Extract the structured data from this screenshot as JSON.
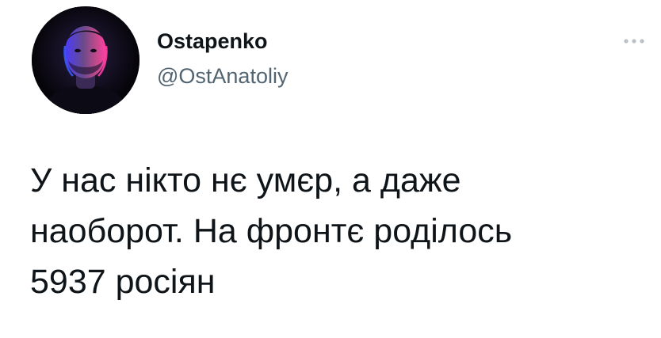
{
  "author": {
    "display_name": "Ostapenko",
    "handle": "@OstAnatoliy",
    "avatar_icon": "profile-photo"
  },
  "more_icon": "more-dots-icon",
  "tweet": {
    "lines": [
      "У нас нікто нє умєр, а даже",
      "наоборот. На фронтє роділось",
      "5937 росіян"
    ]
  },
  "colors": {
    "text": "#0f1419",
    "secondary": "#536471",
    "avatar_bg": "#0a0812",
    "avatar_rim_blue": "#3b5bff",
    "avatar_rim_pink": "#ff3fa4"
  }
}
